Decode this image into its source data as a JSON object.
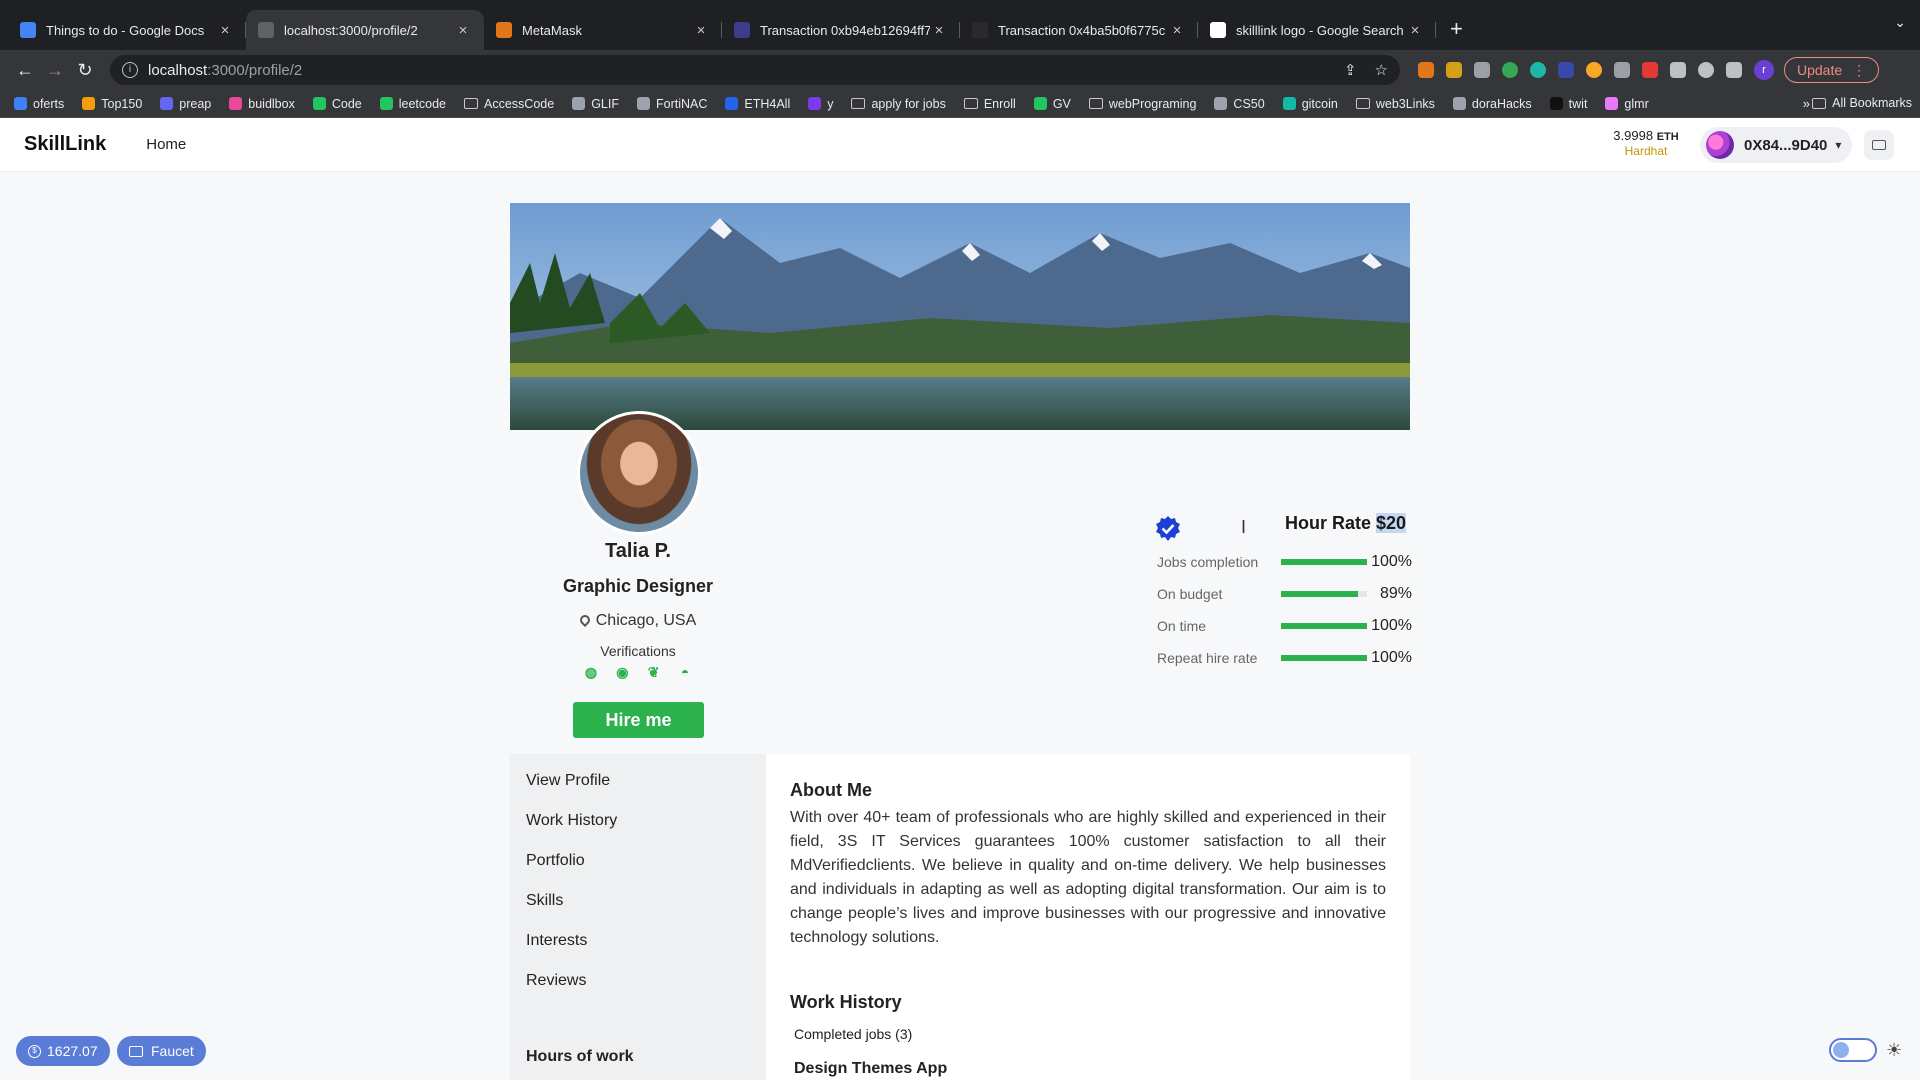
{
  "browser": {
    "tabs": [
      {
        "title": "Things to do - Google Docs",
        "favicon_color": "#4285f4",
        "active": false
      },
      {
        "title": "localhost:3000/profile/2",
        "favicon_color": "#5f6368",
        "active": true
      },
      {
        "title": "MetaMask",
        "favicon_color": "#e2761b",
        "active": false
      },
      {
        "title": "Transaction 0xb94eb12694ff7",
        "favicon_color": "#3c3c8c",
        "active": false
      },
      {
        "title": "Transaction 0x4ba5b0f6775c",
        "favicon_color": "#2a2a2a",
        "active": false
      },
      {
        "title": "skilllink logo - Google Search",
        "favicon_color": "#ffffff",
        "active": false
      }
    ],
    "url_host": "localhost",
    "url_path": ":3000/profile/2",
    "update_label": "Update",
    "profile_initial": "r",
    "bookmarks": [
      {
        "label": "oferts",
        "color": "#3b82f6",
        "type": "site"
      },
      {
        "label": "Top150",
        "color": "#f59e0b",
        "type": "site"
      },
      {
        "label": "preap",
        "color": "#6366f1",
        "type": "site"
      },
      {
        "label": "buidlbox",
        "color": "#ec4899",
        "type": "site"
      },
      {
        "label": "Code",
        "color": "#22c55e",
        "type": "site"
      },
      {
        "label": "leetcode",
        "color": "#22c55e",
        "type": "site"
      },
      {
        "label": "AccessCode",
        "color": "",
        "type": "folder"
      },
      {
        "label": "GLIF",
        "color": "#9ca3af",
        "type": "site"
      },
      {
        "label": "FortiNAC",
        "color": "#9ca3af",
        "type": "site"
      },
      {
        "label": "ETH4All",
        "color": "#2563eb",
        "type": "site"
      },
      {
        "label": "y",
        "color": "#7c3aed",
        "type": "site"
      },
      {
        "label": "apply for jobs",
        "color": "",
        "type": "folder"
      },
      {
        "label": "Enroll",
        "color": "",
        "type": "folder"
      },
      {
        "label": "GV",
        "color": "#22c55e",
        "type": "site"
      },
      {
        "label": "webPrograming",
        "color": "",
        "type": "folder"
      },
      {
        "label": "CS50",
        "color": "#9ca3af",
        "type": "site"
      },
      {
        "label": "gitcoin",
        "color": "#14b8a6",
        "type": "site"
      },
      {
        "label": "web3Links",
        "color": "",
        "type": "folder"
      },
      {
        "label": "doraHacks",
        "color": "#9ca3af",
        "type": "site"
      },
      {
        "label": "twit",
        "color": "#111111",
        "type": "site"
      },
      {
        "label": "glmr",
        "color": "#e879f9",
        "type": "site"
      }
    ],
    "bookmarks_more": "»",
    "all_bookmarks": "All Bookmarks"
  },
  "app": {
    "brand": "SkillLink",
    "nav_home": "Home",
    "balance": "3.9998",
    "balance_unit": "ETH",
    "network": "Hardhat",
    "account_address": "0X84...9D40"
  },
  "profile": {
    "name": "Talia P.",
    "role": "Graphic Designer",
    "location": "Chicago, USA",
    "verifications_label": "Verifications",
    "verification_icons": [
      "globe-icon",
      "github-icon",
      "twitter-icon",
      "discord-icon"
    ],
    "hire_label": "Hire me",
    "hour_rate_label": "Hour Rate",
    "hour_rate_value": "$20",
    "stats": [
      {
        "label": "Jobs completion",
        "value": "100%",
        "fraction": 1.0
      },
      {
        "label": "On budget",
        "value": "89%",
        "fraction": 0.89
      },
      {
        "label": "On time",
        "value": "100%",
        "fraction": 1.0
      },
      {
        "label": "Repeat hire rate",
        "value": "100%",
        "fraction": 1.0
      }
    ]
  },
  "sidenav": {
    "items": [
      "View Profile",
      "Work History",
      "Portfolio",
      "Skills",
      "Interests",
      "Reviews"
    ],
    "hours_heading": "Hours of work"
  },
  "about": {
    "heading": "About Me",
    "text": "With over 40+ team of professionals who are highly skilled and experienced in their field, 3S IT Services guarantees 100% customer satisfaction to all their MdVerifiedclients. We believe in quality and on-time delivery. We help businesses and individuals in adapting as well as adopting digital transformation. Our aim is to change people’s lives and improve businesses with our progressive and innovative technology solutions."
  },
  "work_history": {
    "heading": "Work History",
    "completed": "Completed jobs (3)",
    "first_job": "Design Themes App"
  },
  "widgets": {
    "points": "1627.07",
    "faucet": "Faucet"
  },
  "colors": {
    "accent_green": "#2bb24c",
    "pill_blue": "#5a7bd6",
    "hardhat_yellow": "#c79400"
  }
}
